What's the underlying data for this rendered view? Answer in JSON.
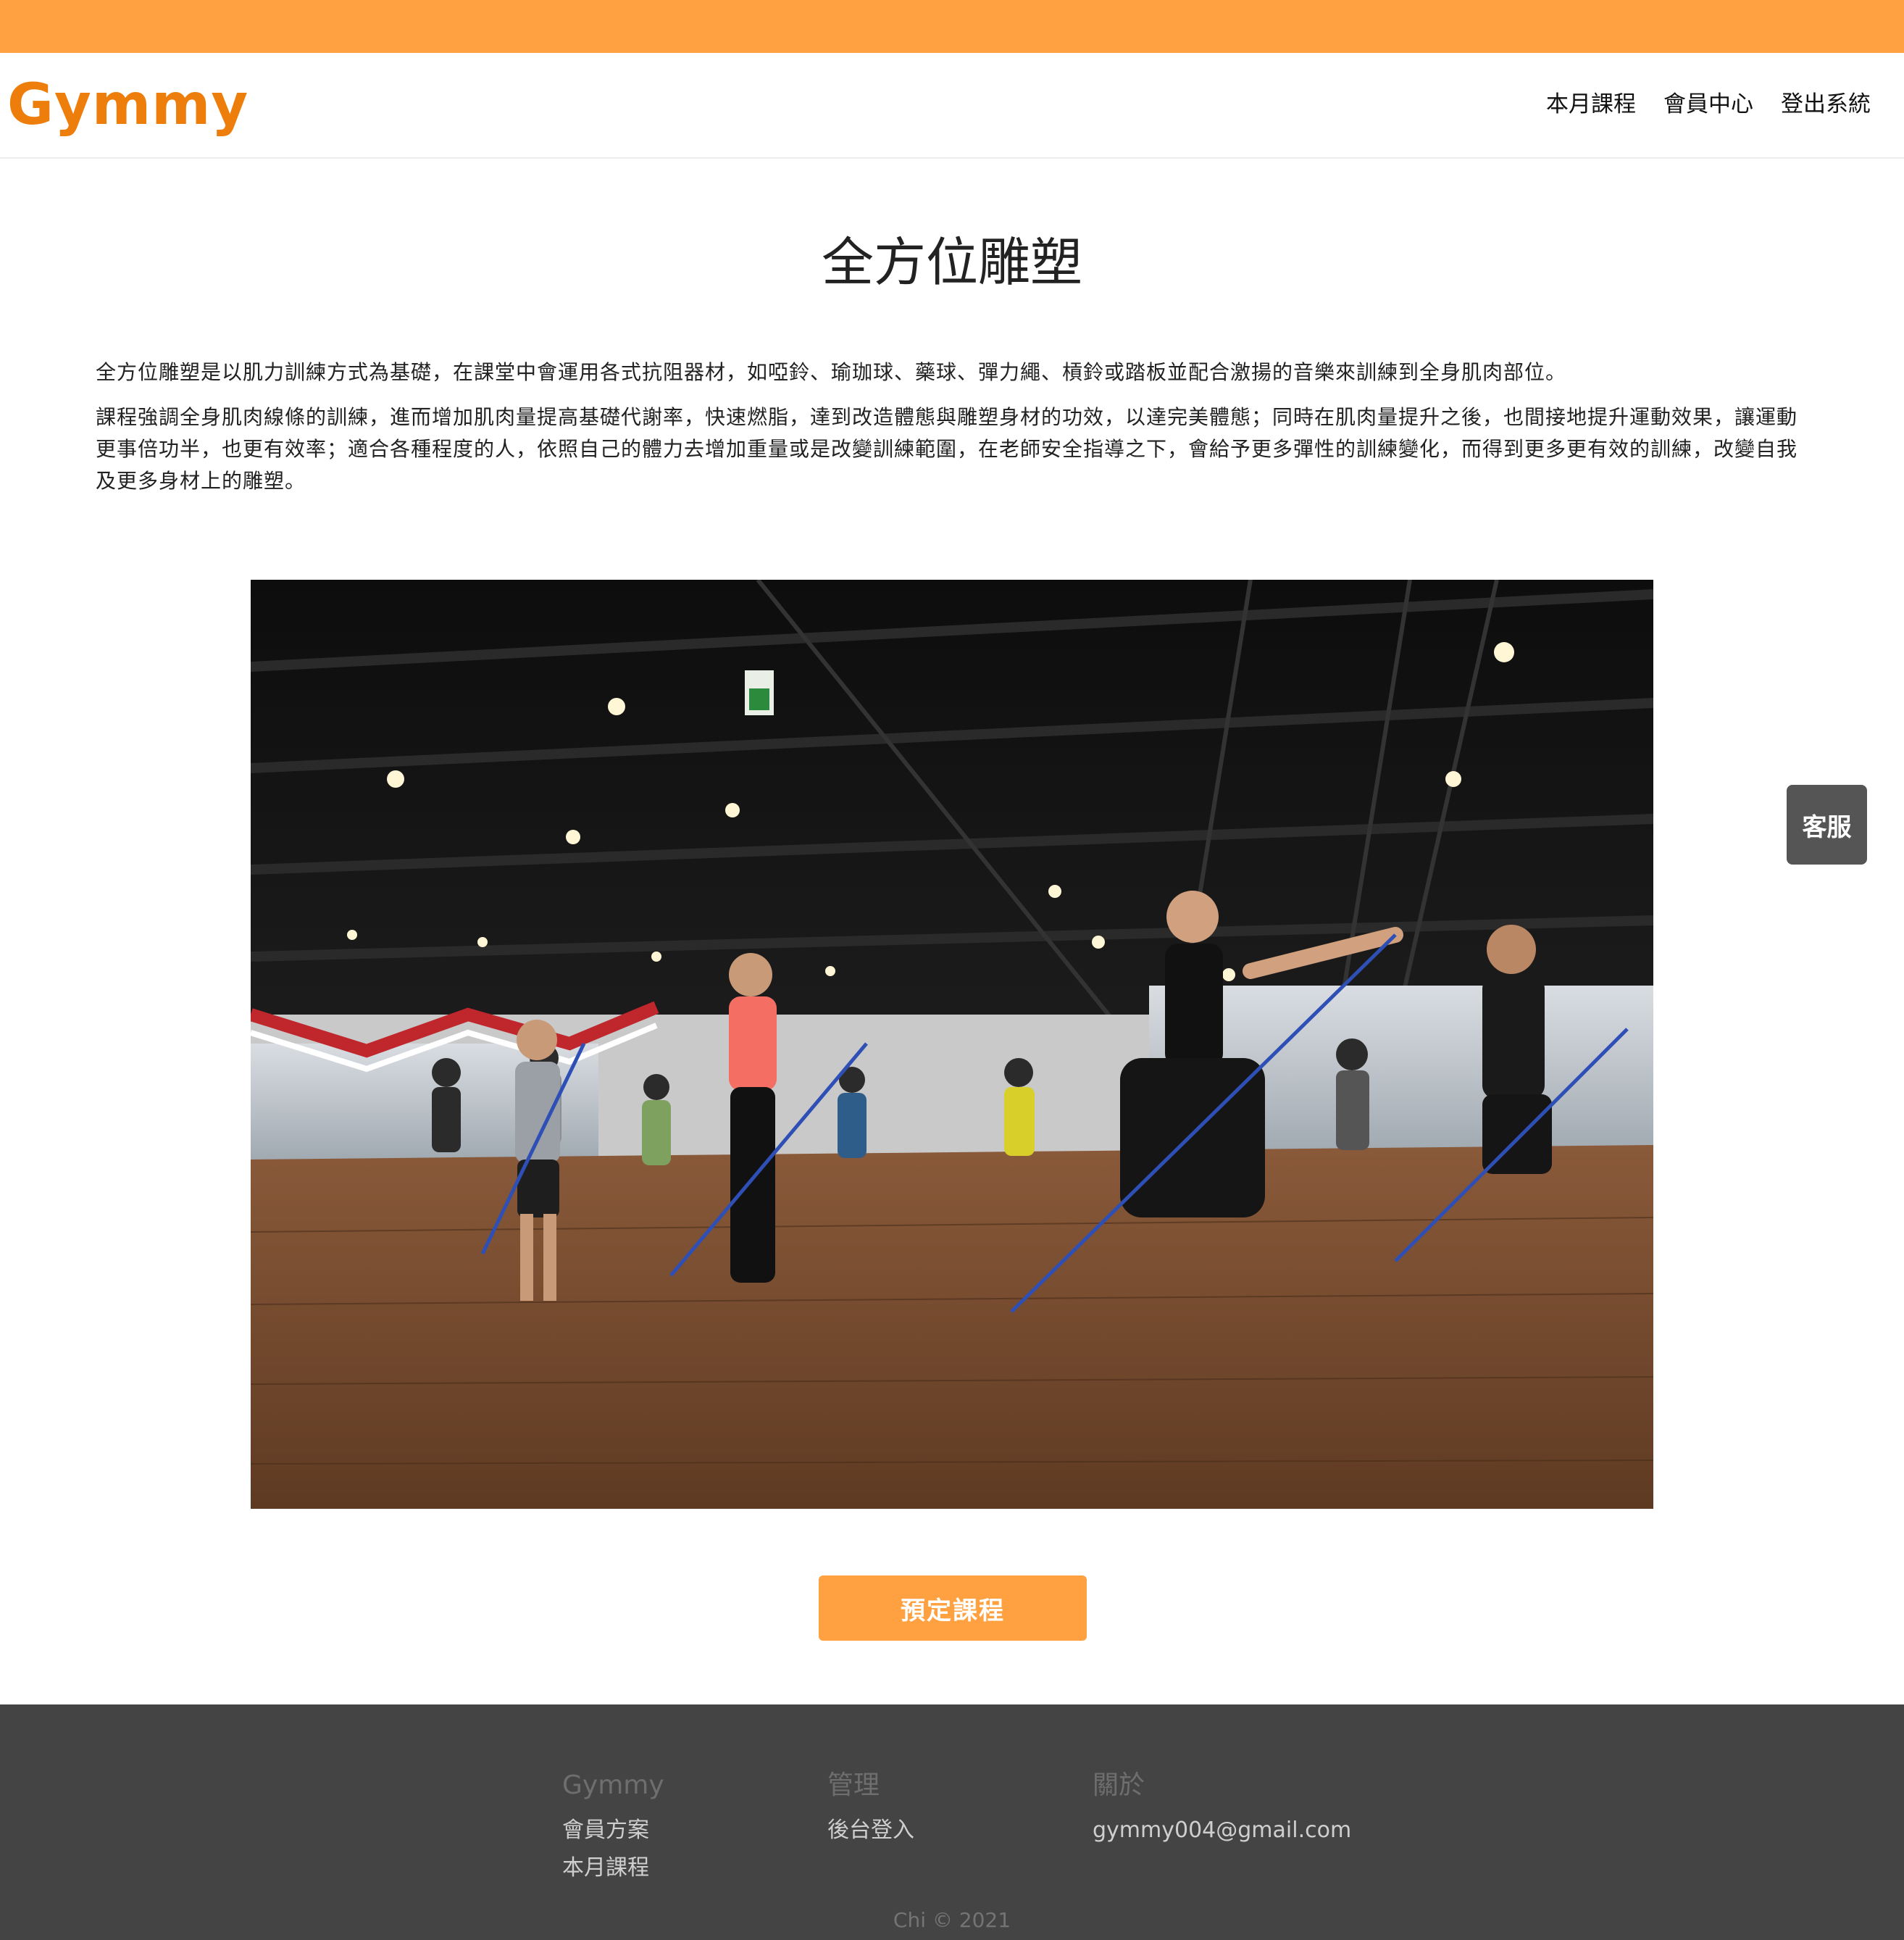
{
  "header": {
    "brand": "Gymmy",
    "nav": [
      {
        "label": "本月課程"
      },
      {
        "label": "會員中心"
      },
      {
        "label": "登出系統"
      }
    ]
  },
  "course": {
    "title": "全方位雕塑",
    "paragraphs": [
      "全方位雕塑是以肌力訓練方式為基礎，在課堂中會運用各式抗阻器材，如啞鈴、瑜珈球、藥球、彈力繩、槓鈴或踏板並配合激揚的音樂來訓練到全身肌肉部位。",
      "課程強調全身肌肉線條的訓練，進而增加肌肉量提高基礎代謝率，快速燃脂，達到改造體態與雕塑身材的功效，以達完美體態；同時在肌肉量提升之後，也間接地提升運動效果，讓運動更事倍功半，也更有效率；適合各種程度的人，依照自己的體力去增加重量或是改變訓練範圍，在老師安全指導之下，會給予更多彈性的訓練變化，而得到更多更有效的訓練，改變自我及更多身材上的雕塑。"
    ],
    "book_button": "預定課程"
  },
  "service_button": "客服",
  "footer": {
    "columns": [
      {
        "heading": "Gymmy",
        "links": [
          "會員方案",
          "本月課程"
        ]
      },
      {
        "heading": "管理",
        "links": [
          "後台登入"
        ]
      },
      {
        "heading": "關於",
        "text": "gymmy004@gmail.com"
      }
    ],
    "copyright": "Chi © 2021"
  },
  "colors": {
    "accent": "#ffa140",
    "brand": "#ee7e0c",
    "footer_bg": "#444444",
    "service_bg": "#555555"
  }
}
